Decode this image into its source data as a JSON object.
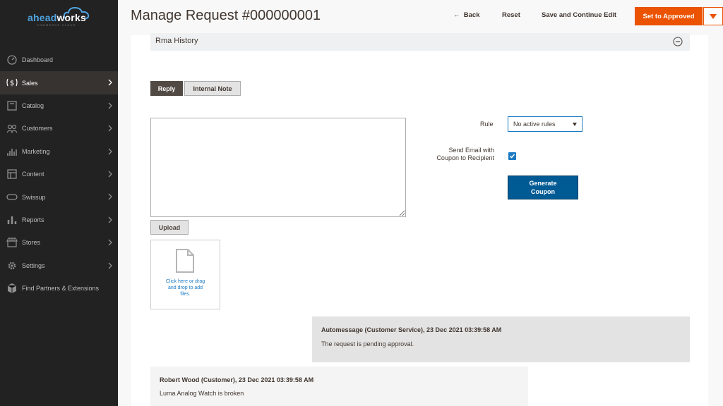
{
  "brand": {
    "logo_main": "ahead",
    "logo_accent": "works",
    "logo_tagline": "COMMERCE CLOUD"
  },
  "sidebar": {
    "items": [
      {
        "label": "Dashboard",
        "icon": "dashboard-icon",
        "active": false,
        "has_children": false
      },
      {
        "label": "Sales",
        "icon": "dollar-icon",
        "active": true,
        "has_children": true
      },
      {
        "label": "Catalog",
        "icon": "box-icon",
        "active": false,
        "has_children": true
      },
      {
        "label": "Customers",
        "icon": "users-icon",
        "active": false,
        "has_children": true
      },
      {
        "label": "Marketing",
        "icon": "bar-chart-icon",
        "active": false,
        "has_children": true
      },
      {
        "label": "Content",
        "icon": "layout-icon",
        "active": false,
        "has_children": true
      },
      {
        "label": "Swissup",
        "icon": "cloud-icon",
        "active": false,
        "has_children": true
      },
      {
        "label": "Reports",
        "icon": "report-bars-icon",
        "active": false,
        "has_children": true
      },
      {
        "label": "Stores",
        "icon": "store-icon",
        "active": false,
        "has_children": true
      },
      {
        "label": "Settings",
        "icon": "gear-icon",
        "active": false,
        "has_children": true
      },
      {
        "label": "Find Partners & Extensions",
        "icon": "extensions-icon",
        "active": false,
        "has_children": false
      }
    ]
  },
  "header": {
    "title": "Manage Request #000000001",
    "back_label": "Back",
    "reset_label": "Reset",
    "save_label": "Save and Continue Edit",
    "approve_label": "Set to Approved"
  },
  "rma_history": {
    "title": "Rma History",
    "collapse_icon": "minus-circle-icon"
  },
  "tabs": {
    "reply": "Reply",
    "internal_note": "Internal Note",
    "active": "reply"
  },
  "reply": {
    "value": ""
  },
  "coupon": {
    "rule_label": "Rule",
    "rule_value": "No active rules",
    "send_line1": "Send Email with",
    "send_line2": "Coupon to Recipient",
    "send_checked": true,
    "generate_line1": "Generate",
    "generate_line2": "Coupon"
  },
  "upload": {
    "button_label": "Upload",
    "drop_line1": "Click here or drag",
    "drop_line2": "and drop to add",
    "drop_line3": "files."
  },
  "messages": [
    {
      "author": "Automessage (Customer Service), 23 Dec 2021 03:39:58 AM",
      "text": "The request is pending approval."
    },
    {
      "author": "Robert Wood (Customer), 23 Dec 2021 03:39:58 AM",
      "text": "Luma Analog Watch is broken"
    }
  ],
  "colors": {
    "sidebar_bg": "#222222",
    "accent": "#eb5202",
    "primary": "#005a94",
    "link": "#1979c3"
  }
}
